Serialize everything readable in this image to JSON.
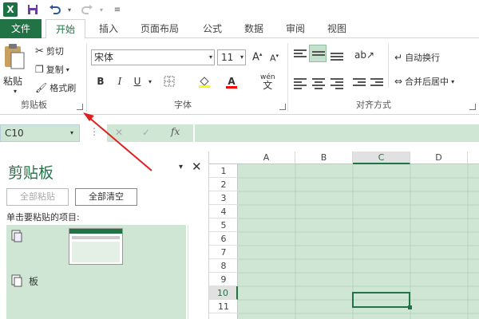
{
  "titlebar": {
    "app_icon_letter": "X",
    "save_icon": "save-icon",
    "undo_icon": "undo-icon",
    "redo_icon": "redo-icon",
    "qat_menu_icon": "customize-qat-icon"
  },
  "tabs": [
    {
      "label": "文件"
    },
    {
      "label": "开始"
    },
    {
      "label": "插入"
    },
    {
      "label": "页面布局"
    },
    {
      "label": "公式"
    },
    {
      "label": "数据"
    },
    {
      "label": "审阅"
    },
    {
      "label": "视图"
    }
  ],
  "clipboard_group": {
    "paste_label": "粘贴",
    "cut_label": "剪切",
    "copy_label": "复制",
    "format_painter_label": "格式刷",
    "group_label": "剪贴板"
  },
  "font_group": {
    "font_name": "宋体",
    "font_size": "11",
    "bold": "B",
    "italic": "I",
    "underline": "U",
    "phonetic": "wén",
    "phonetic_char": "文",
    "group_label": "字体",
    "fill_color": "#ffff00",
    "font_color": "#ff0000"
  },
  "alignment_group": {
    "wrap_text_label": "自动换行",
    "merge_center_label": "合并后居中",
    "group_label": "对齐方式"
  },
  "formula_bar": {
    "name_box": "C10",
    "cancel": "✕",
    "enter": "✓",
    "fx": "fx",
    "formula_value": ""
  },
  "clipboard_pane": {
    "title": "剪贴板",
    "paste_all": "全部粘贴",
    "clear_all": "全部清空",
    "hint": "单击要粘贴的项目:",
    "items": [
      {
        "type": "image"
      },
      {
        "type": "text",
        "text": "板"
      }
    ]
  },
  "sheet": {
    "columns": [
      "A",
      "B",
      "C",
      "D"
    ],
    "rows": [
      "1",
      "2",
      "3",
      "4",
      "5",
      "6",
      "7",
      "8",
      "9",
      "10",
      "11"
    ],
    "active_cell": "C10"
  },
  "colors": {
    "accent": "#217346",
    "selection_fill": "#cfe6d4",
    "annotation_arrow": "#e02020"
  }
}
